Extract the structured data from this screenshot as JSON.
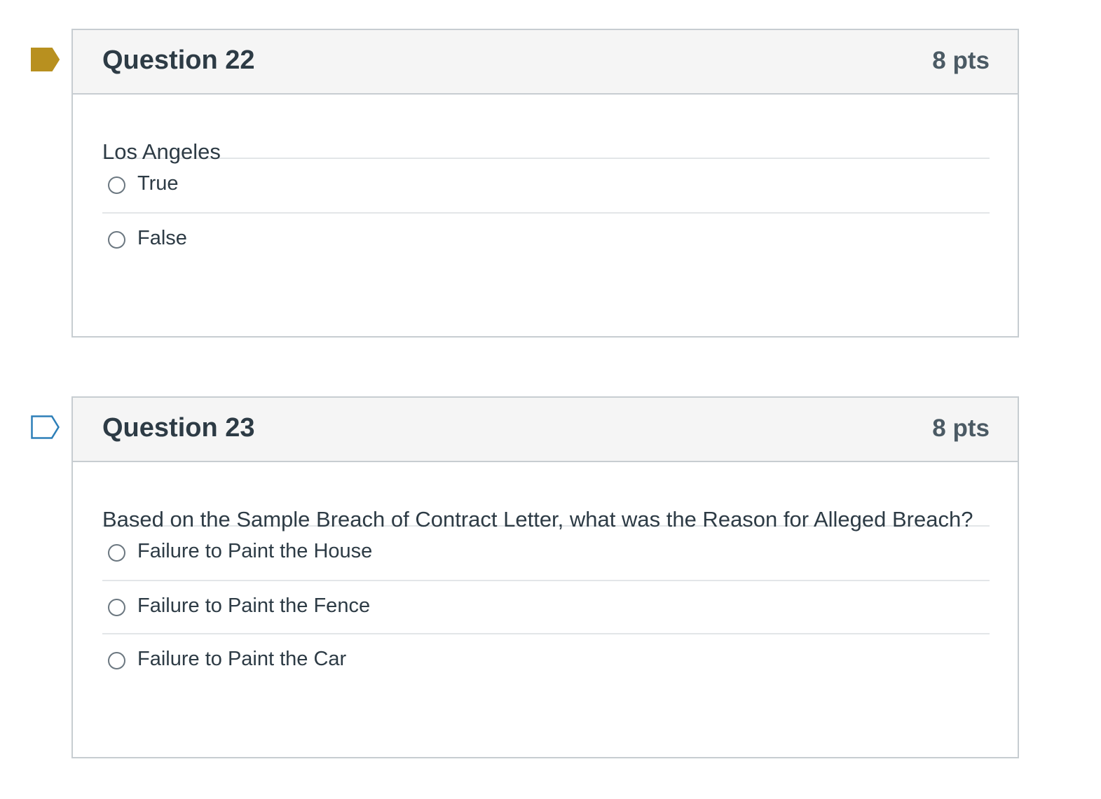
{
  "questions": [
    {
      "title": "Question 22",
      "points": "8 pts",
      "flagged": true,
      "flag_color": "#b8901f",
      "text": "Los Angeles",
      "answers": [
        {
          "label": "True"
        },
        {
          "label": "False"
        }
      ]
    },
    {
      "title": "Question 23",
      "points": "8 pts",
      "flagged": false,
      "flag_color": "#2d7fb8",
      "text": "Based on the Sample Breach of Contract Letter, what was the Reason for Alleged Breach?",
      "answers": [
        {
          "label": "Failure to Paint the House"
        },
        {
          "label": "Failure to Paint the Fence"
        },
        {
          "label": "Failure to Paint the Car"
        }
      ]
    }
  ]
}
